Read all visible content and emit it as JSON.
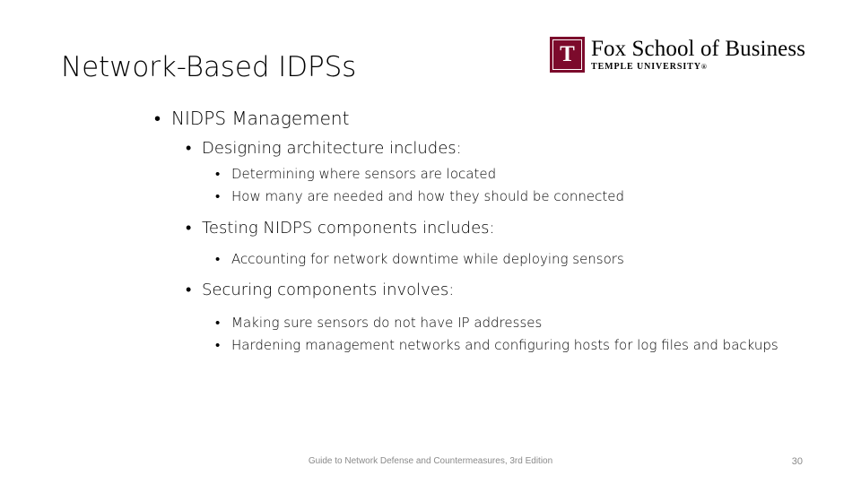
{
  "slide": {
    "title": "Network-Based IDPSs",
    "background_color": "#ffffff",
    "text_color": "#000000"
  },
  "logo": {
    "mark_letter": "T",
    "mark_color": "#7c0a2c",
    "title": "Fox School of Business",
    "subtitle": "TEMPLE UNIVERSITY",
    "registered_mark": "®"
  },
  "content": {
    "level1": {
      "marker": "•",
      "text": "NIDPS Management"
    },
    "groups": [
      {
        "heading": {
          "marker": "•",
          "text": "Designing architecture includes:"
        },
        "items": [
          {
            "marker": "•",
            "text": "Determining where sensors are located"
          },
          {
            "marker": "•",
            "text": "How many are needed and how they should be connected"
          }
        ]
      },
      {
        "heading": {
          "marker": "•",
          "text": "Testing NIDPS components includes:"
        },
        "items": [
          {
            "marker": "•",
            "text": "Accounting for network downtime while deploying sensors"
          }
        ]
      },
      {
        "heading": {
          "marker": "•",
          "text": "Securing components involves:"
        },
        "items": [
          {
            "marker": "•",
            "text": "Making sure sensors do not have IP addresses"
          },
          {
            "marker": "•",
            "text": "Hardening management networks and configuring hosts for log files and backups"
          }
        ]
      }
    ]
  },
  "footer": {
    "source": "Guide to Network Defense and Countermeasures, 3rd Edition",
    "page_number": "30",
    "color": "#8a8a8a"
  }
}
